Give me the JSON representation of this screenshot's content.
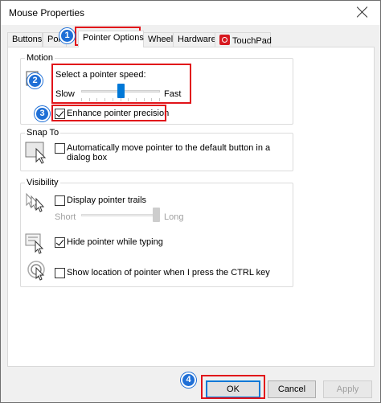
{
  "window": {
    "title": "Mouse Properties"
  },
  "tabs": [
    {
      "label": "Buttons"
    },
    {
      "label": "Poi"
    },
    {
      "label": "Pointer Options"
    },
    {
      "label": "Wheel"
    },
    {
      "label": "Hardware"
    },
    {
      "label": "TouchPad"
    }
  ],
  "motion": {
    "group_label": "Motion",
    "speed_label": "Select a pointer speed:",
    "slow_label": "Slow",
    "fast_label": "Fast",
    "speed_value": 0.5,
    "enhance_label": "Enhance pointer precision",
    "enhance_checked": true
  },
  "snap": {
    "group_label": "Snap To",
    "line1": "Automatically move pointer to the default button in a",
    "line2": "dialog box",
    "checked": false
  },
  "visibility": {
    "group_label": "Visibility",
    "trails_label": "Display pointer trails",
    "trails_checked": false,
    "short_label": "Short",
    "long_label": "Long",
    "trails_value": 1.0,
    "hide_label": "Hide pointer while typing",
    "hide_checked": true,
    "show_location_label": "Show location of pointer when I press the CTRL key",
    "show_location_checked": false
  },
  "buttons": {
    "ok": "OK",
    "cancel": "Cancel",
    "apply": "Apply"
  },
  "annotations": {
    "badge1": "1",
    "badge2": "2",
    "badge3": "3",
    "badge4": "4",
    "highlight_color": "#e1131a",
    "badge_color": "#1f6fd6"
  }
}
